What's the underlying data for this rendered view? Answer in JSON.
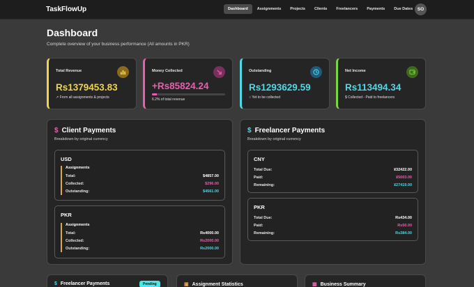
{
  "app": {
    "brand": "TaskFlowUp",
    "avatar": "SO"
  },
  "nav": {
    "items": [
      "Dashboard",
      "Assignments",
      "Projects",
      "Clients",
      "Freelancers",
      "Payments",
      "Due Dates"
    ],
    "active": "Dashboard"
  },
  "header": {
    "title": "Dashboard",
    "subtitle": "Complete overview of your business performance (All amounts in PKR)"
  },
  "stats": [
    {
      "label": "Total Revenue",
      "value": "Rs1379453.83",
      "note": "↗ From all assignments & projects",
      "color": "#f0d44a",
      "icon": "bar-chart-icon"
    },
    {
      "label": "Money Collected",
      "value": "+Rs85824.24",
      "note": "6.2% of total revenue",
      "color": "#e85fb0",
      "icon": "arrow-down-right-icon",
      "progress_percent": 6.2
    },
    {
      "label": "Outstanding",
      "value": "Rs1293629.59",
      "note": "○ Yet to be collected",
      "color": "#4fd8e8",
      "icon": "clock-icon"
    },
    {
      "label": "Net Income",
      "value": "Rs113494.34",
      "note": "$ Collected - Paid to freelancers",
      "color": "#7cd640",
      "icon": "wallet-icon"
    }
  ],
  "client_payments": {
    "title": "Client Payments",
    "subtitle": "Breakdown by original currency",
    "groups": [
      {
        "currency": "USD",
        "section": "Assignments",
        "total_label": "Total:",
        "total": "$4857.00",
        "collected_label": "Collected:",
        "collected": "$296.00",
        "outstanding_label": "Outstanding:",
        "outstanding": "$4561.00"
      },
      {
        "currency": "PKR",
        "section": "Assignments",
        "total_label": "Total:",
        "total": "Rs4000.00",
        "collected_label": "Collected:",
        "collected": "Rs2000.00",
        "outstanding_label": "Outstanding:",
        "outstanding": "Rs2000.00"
      }
    ]
  },
  "freelancer_payments": {
    "title": "Freelancer Payments",
    "subtitle": "Breakdown by original currency",
    "groups": [
      {
        "currency": "CNY",
        "due_label": "Total Due:",
        "due": "¥32422.00",
        "paid_label": "Paid:",
        "paid": "¥5003.00",
        "remaining_label": "Remaining:",
        "remaining": "¥27419.00"
      },
      {
        "currency": "PKR",
        "due_label": "Total Due:",
        "due": "Rs434.00",
        "paid_label": "Paid:",
        "paid": "Rs50.00",
        "remaining_label": "Remaining:",
        "remaining": "Rs384.00"
      }
    ]
  },
  "bottom": {
    "cards": [
      {
        "title": "Freelancer Payments",
        "badge": "Pending"
      },
      {
        "title": "Assignment Statistics"
      },
      {
        "title": "Business Summary"
      }
    ]
  },
  "colors": {
    "pink": "#e85fb0",
    "cyan": "#4fd8e8",
    "yellow": "#f0d44a",
    "green": "#7cd640"
  }
}
